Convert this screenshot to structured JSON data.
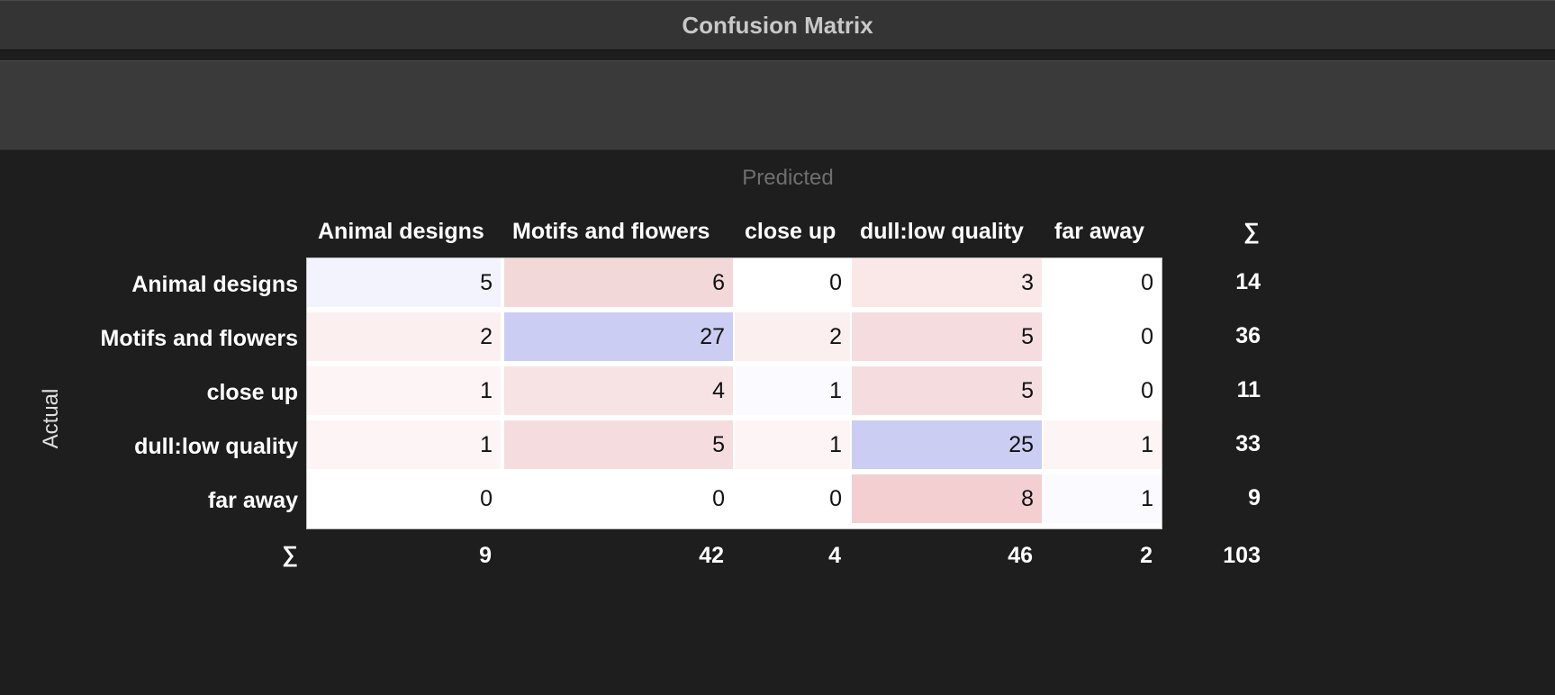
{
  "window": {
    "title": "Confusion Matrix"
  },
  "axes": {
    "predicted": "Predicted",
    "actual": "Actual",
    "sum_symbol": "∑"
  },
  "classes": [
    "Animal designs",
    "Motifs and flowers",
    "close up",
    "dull:low quality",
    "far away"
  ],
  "matrix": [
    [
      5,
      6,
      0,
      3,
      0
    ],
    [
      2,
      27,
      2,
      5,
      0
    ],
    [
      1,
      4,
      1,
      5,
      0
    ],
    [
      1,
      5,
      1,
      25,
      1
    ],
    [
      0,
      0,
      0,
      8,
      1
    ]
  ],
  "row_sums": [
    14,
    36,
    11,
    33,
    9
  ],
  "col_sums": [
    9,
    42,
    4,
    46,
    2
  ],
  "total": 103,
  "colors": {
    "window_bg": "#1e1e1e",
    "titlebar_bg": "#343434",
    "toolbar_bg": "#3a3a3a",
    "correct_cell": "#cbcdf3",
    "error_cell": "#f3cfd1"
  },
  "cell_fills": [
    [
      "#f2f3fd",
      "#f3d8da",
      "#ffffff",
      "#fae8e9",
      "#ffffff"
    ],
    [
      "#fbefef",
      "#cbcdf3",
      "#fbefef",
      "#f5dddf",
      "#ffffff"
    ],
    [
      "#fdf5f5",
      "#f8e3e4",
      "#fafaff",
      "#f5dddf",
      "#ffffff"
    ],
    [
      "#fdf5f5",
      "#f5dddf",
      "#fdf5f5",
      "#cbcdf3",
      "#fdf5f5"
    ],
    [
      "#ffffff",
      "#ffffff",
      "#ffffff",
      "#f3cfd1",
      "#fafaff"
    ]
  ]
}
